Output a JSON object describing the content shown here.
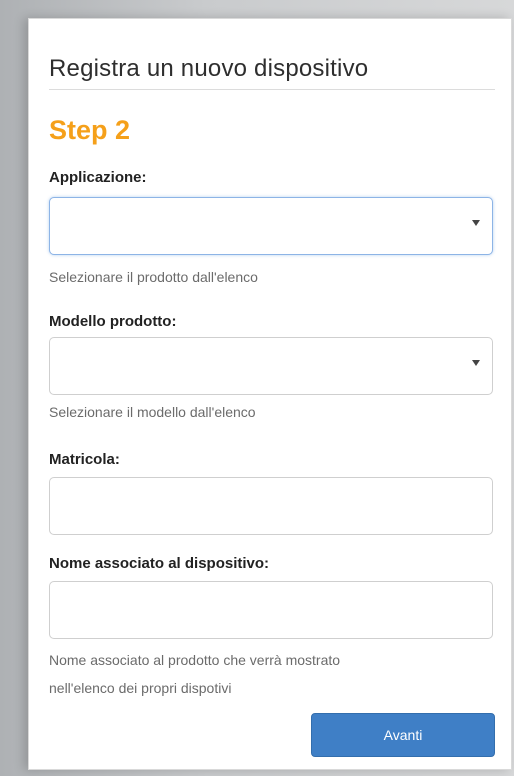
{
  "form": {
    "title": "Registra un nuovo dispositivo",
    "step": "Step 2",
    "accent_color": "#f5a01a",
    "button_color": "#3f7fc6",
    "fields": {
      "application": {
        "label": "Applicazione:",
        "value": "",
        "help": "Selezionare il prodotto dall'elenco",
        "icon": "chevron-down-icon"
      },
      "model": {
        "label": "Modello prodotto:",
        "value": "",
        "help": "Selezionare il modello dall'elenco",
        "icon": "chevron-down-icon"
      },
      "serial": {
        "label": "Matricola:",
        "value": ""
      },
      "device_name": {
        "label": "Nome associato al dispositivo:",
        "value": "",
        "help_line1": "Nome associato al prodotto che verrà mostrato",
        "help_line2": "nell'elenco dei propri dispotivi"
      }
    },
    "next_label": "Avanti"
  }
}
